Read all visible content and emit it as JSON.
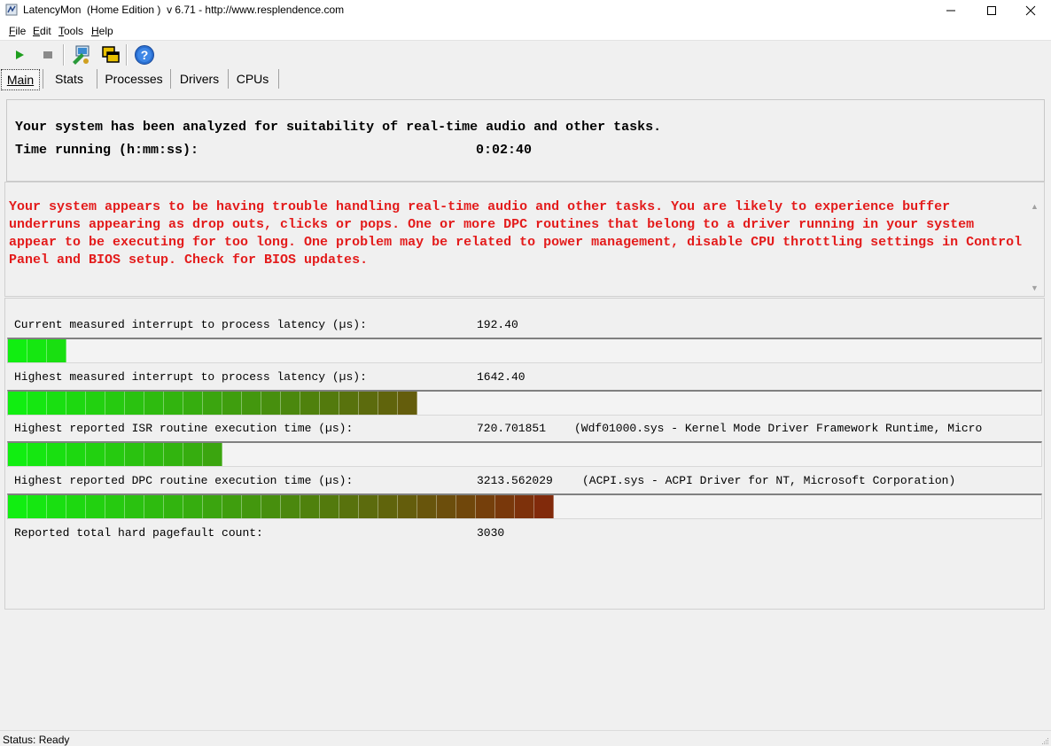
{
  "window": {
    "title": "LatencyMon  (Home Edition )  v 6.71 - http://www.resplendence.com"
  },
  "menu": [
    {
      "label": "File",
      "u": "F",
      "rest": "ile"
    },
    {
      "label": "Edit",
      "u": "E",
      "rest": "dit"
    },
    {
      "label": "Tools",
      "u": "T",
      "rest": "ools"
    },
    {
      "label": "Help",
      "u": "H",
      "rest": "elp"
    }
  ],
  "toolbar": {
    "icons": [
      "play-icon",
      "stop-icon",
      "drivers-monitor-icon",
      "windows-icon",
      "help-icon"
    ],
    "colors": {
      "play": "#1e9e1e",
      "stop": "#8a8a8a",
      "help": "#2a6fd0"
    }
  },
  "tabs": [
    {
      "label": "Main",
      "active": true
    },
    {
      "label": "Stats",
      "active": false
    },
    {
      "label": "Processes",
      "active": false
    },
    {
      "label": "Drivers",
      "active": false
    },
    {
      "label": "CPUs",
      "active": false
    }
  ],
  "summary": {
    "analyzed": "Your system has been analyzed for suitability of real-time audio and other tasks.",
    "time_label": "Time running (h:mm:ss):",
    "time_value": "0:02:40"
  },
  "warning": {
    "text": "Your system appears to be having trouble handling real-time audio and other tasks. You are likely to experience buffer underruns appearing as drop outs, clicks or pops. One or more DPC routines that belong to a driver running in your system appear to be executing for too long. One problem may be related to power management, disable CPU throttling settings in Control Panel and BIOS setup. Check for BIOS updates.",
    "color": "#e31b1b"
  },
  "metrics": {
    "current_latency": {
      "label": "Current measured interrupt to process latency (µs):",
      "value": "192.40",
      "meter_segments": 3
    },
    "highest_latency": {
      "label": "Highest measured interrupt to process latency (µs):",
      "value": "1642.40",
      "meter_segments": 21
    },
    "highest_isr": {
      "label": "Highest reported ISR routine execution time (µs):",
      "value": "720.701851",
      "detail": "(Wdf01000.sys - Kernel Mode Driver Framework Runtime, Micro",
      "meter_segments": 11
    },
    "highest_dpc": {
      "label": "Highest reported DPC routine execution time (µs):",
      "value": "3213.562029",
      "detail": "(ACPI.sys - ACPI Driver for NT, Microsoft Corporation)",
      "meter_segments": 28
    },
    "pagefaults": {
      "label": "Reported total hard pagefault count:",
      "value": "3030"
    }
  },
  "meter_colors": {
    "start": "#11ee11",
    "end": "#8a1a0a"
  },
  "status": {
    "text": "Status: Ready"
  }
}
